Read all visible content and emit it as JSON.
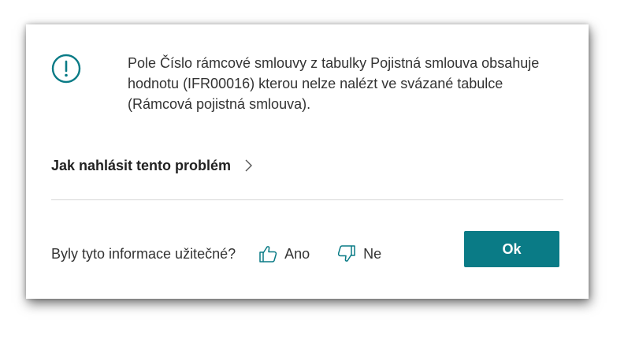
{
  "message": {
    "icon": "exclamation-circle-icon",
    "lines": [
      "Pole Číslo rámcové smlouvy z tabulky Pojistná smlouva obsahuje",
      "hodnotu (IFR00016) kterou nelze nalézt ve svázané tabulce",
      "(Rámcová pojistná smlouva)."
    ]
  },
  "report": {
    "label": "Jak nahlásit tento problém",
    "icon": "chevron-right-icon"
  },
  "feedback": {
    "question": "Byly tyto informace užitečné?",
    "yes_label": "Ano",
    "yes_icon": "thumbs-up-icon",
    "no_label": "Ne",
    "no_icon": "thumbs-down-icon"
  },
  "ok_button": {
    "label": "Ok"
  },
  "colors": {
    "accent": "#0a7b86",
    "text": "#333333"
  }
}
